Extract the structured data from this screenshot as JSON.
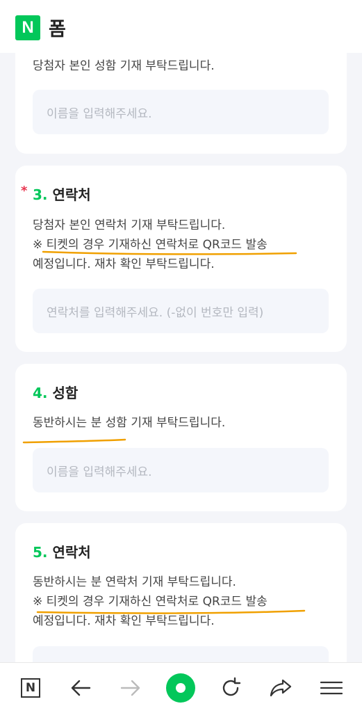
{
  "header": {
    "logo_letter": "N",
    "title": "폼"
  },
  "card2": {
    "description": "당첨자 본인 성함 기재 부탁드립니다.",
    "placeholder": "이름을 입력해주세요."
  },
  "card3": {
    "required_mark": "*",
    "number": "3.",
    "title": "연락처",
    "description_lines": [
      "당첨자 본인 연락처 기재 부탁드립니다.",
      "※ 티켓의 경우 기재하신 연락처로 QR코드 발송",
      "예정입니다. 재차 확인 부탁드립니다."
    ],
    "placeholder": "연락처를 입력해주세요. (-없이 번호만 입력)"
  },
  "card4": {
    "number": "4.",
    "title": "성함",
    "description": "동반하시는 분 성함 기재 부탁드립니다.",
    "placeholder": "이름을 입력해주세요."
  },
  "card5": {
    "number": "5.",
    "title": "연락처",
    "description_lines": [
      "동반하시는 분 연락처 기재 부탁드립니다.",
      "※ 티켓의 경우 기재하신 연락처로 QR코드 발송",
      "예정입니다. 재차 확인 부탁드립니다."
    ]
  },
  "colors": {
    "brand": "#03c75a",
    "required": "#e8344e",
    "annotation": "#f0a000"
  },
  "bottom_nav": {
    "icons": [
      "naver-home-icon",
      "back-arrow-icon",
      "forward-arrow-icon",
      "green-dot-icon",
      "refresh-icon",
      "share-icon",
      "menu-icon"
    ],
    "logo_letter": "N"
  }
}
